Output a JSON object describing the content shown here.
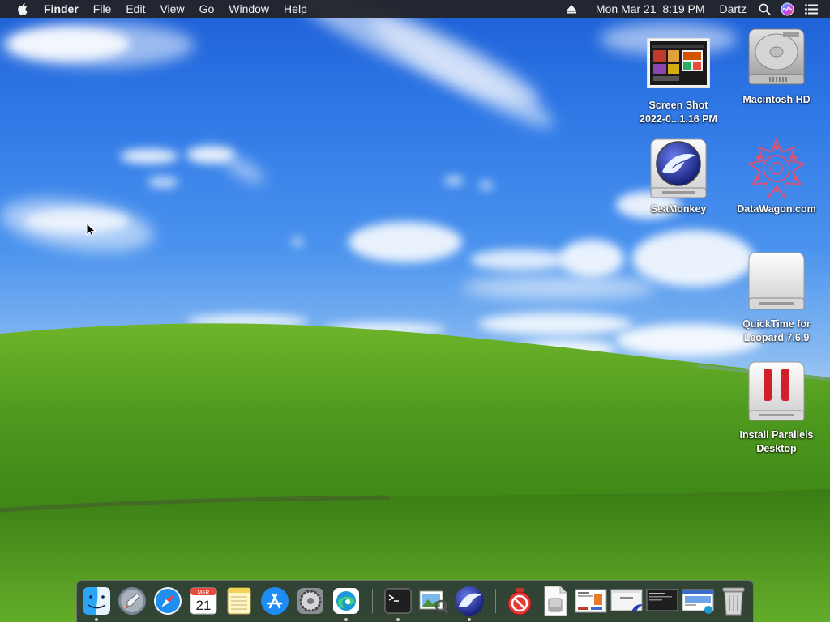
{
  "menubar": {
    "apple_icon": "apple-logo-icon",
    "app_name": "Finder",
    "menus": [
      "File",
      "Edit",
      "View",
      "Go",
      "Window",
      "Help"
    ],
    "status": {
      "eject_icon": "eject-icon",
      "datetime": "Mon Mar 21  8:19 PM",
      "user": "Dartz",
      "search_icon": "spotlight-search-icon",
      "siri_icon": "siri-icon",
      "control_icon": "notification-center-icon"
    }
  },
  "desktop_icons": [
    {
      "label": "Screen Shot\n2022-0...1.16 PM",
      "icon": "screenshot-thumbnail-icon"
    },
    {
      "label": "Macintosh HD",
      "icon": "hard-drive-icon"
    },
    {
      "label": "SeaMonkey",
      "icon": "seamonkey-disk-icon"
    },
    {
      "label": "DataWagon.com",
      "icon": "datawagon-logo-icon"
    },
    {
      "label": "QuickTime for\nLeopard 7.6.9",
      "icon": "external-drive-icon"
    },
    {
      "label": "Install Parallels\nDesktop",
      "icon": "parallels-disk-icon"
    }
  ],
  "dock": {
    "apps": [
      {
        "name": "Finder",
        "icon": "finder-icon",
        "running": true
      },
      {
        "name": "Launchpad",
        "icon": "launchpad-icon",
        "running": false
      },
      {
        "name": "Safari",
        "icon": "safari-icon",
        "running": false
      },
      {
        "name": "Calendar",
        "icon": "calendar-icon",
        "running": false,
        "month": "MAR",
        "day": "21"
      },
      {
        "name": "Notes",
        "icon": "notes-icon",
        "running": false
      },
      {
        "name": "App Store",
        "icon": "app-store-icon",
        "running": false
      },
      {
        "name": "System Preferences",
        "icon": "system-preferences-icon",
        "running": false
      },
      {
        "name": "Microsoft Edge",
        "icon": "edge-icon",
        "running": true
      },
      {
        "name": "Terminal",
        "icon": "terminal-icon",
        "running": true
      },
      {
        "name": "Preview",
        "icon": "preview-icon",
        "running": false
      },
      {
        "name": "SeaMonkey",
        "icon": "seamonkey-icon",
        "running": true
      }
    ],
    "others": [
      {
        "name": "Stop app",
        "icon": "stop-sign-icon"
      },
      {
        "name": "Disk image",
        "icon": "disk-image-icon"
      },
      {
        "name": "Document",
        "icon": "document-thumbnail-icon"
      },
      {
        "name": "Window",
        "icon": "window-thumbnail-icon"
      },
      {
        "name": "Terminal window",
        "icon": "dark-window-thumbnail-icon"
      },
      {
        "name": "Browser window",
        "icon": "browser-window-thumbnail-icon"
      },
      {
        "name": "Trash",
        "icon": "trash-icon"
      }
    ]
  },
  "colors": {
    "sky_top": "#1d5fd6",
    "hill": "#4f9a1f",
    "menubar_bg": "#222226",
    "parallels_red": "#d0202a"
  }
}
